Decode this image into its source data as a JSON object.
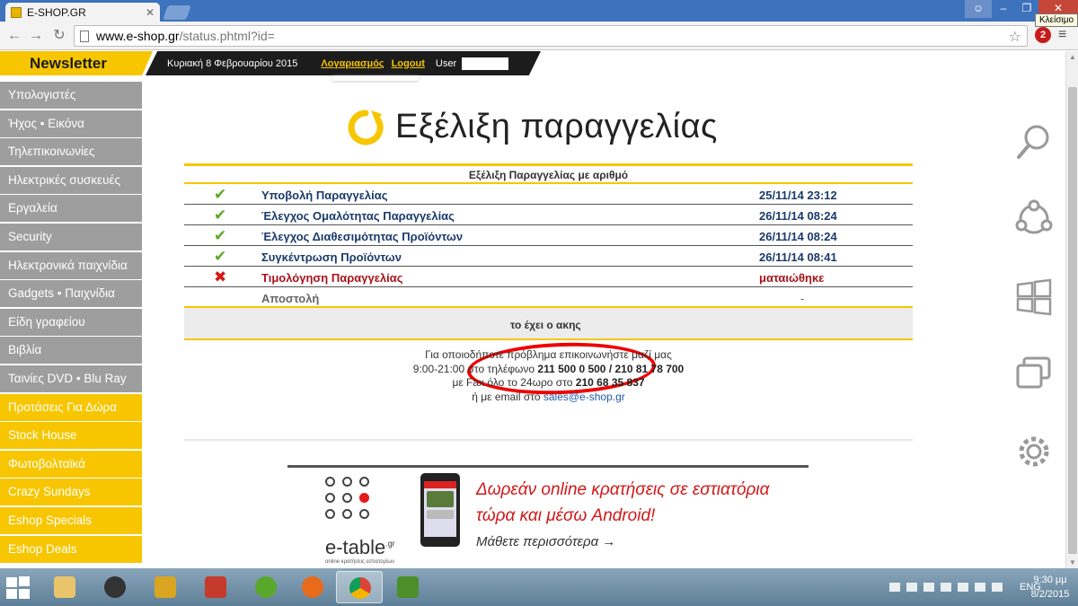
{
  "browser": {
    "tab_title": "E-SHOP.GR",
    "tab_close": "✕",
    "url_domain": "www.e-shop.gr",
    "url_path": "/status.phtml?id=",
    "tooltip": "Κλείσιμο",
    "ext_badge": "2"
  },
  "header": {
    "newsletter": "Newsletter",
    "date": "Κυριακή 8 Φεβρουαρίου 2015",
    "account_link": "Λογαριασμός",
    "logout_link": "Logout",
    "user_label": "User"
  },
  "sidebar": {
    "items": [
      {
        "label": "Υπολογιστές",
        "style": "gray"
      },
      {
        "label": "Ήχος • Εικόνα",
        "style": "gray"
      },
      {
        "label": "Τηλεπικοινωνίες",
        "style": "gray"
      },
      {
        "label": "Ηλεκτρικές συσκευές",
        "style": "gray"
      },
      {
        "label": "Εργαλεία",
        "style": "gray"
      },
      {
        "label": "Security",
        "style": "gray"
      },
      {
        "label": "Ηλεκτρονικά παιχνίδια",
        "style": "gray"
      },
      {
        "label": "Gadgets • Παιχνίδια",
        "style": "gray"
      },
      {
        "label": "Είδη γραφείου",
        "style": "gray"
      },
      {
        "label": "Βιβλία",
        "style": "gray"
      },
      {
        "label": "Ταινίες DVD • Blu Ray",
        "style": "gray"
      },
      {
        "label": "Προτάσεις Για Δώρα",
        "style": "yellow"
      },
      {
        "label": "Stock House",
        "style": "yellow"
      },
      {
        "label": "Φωτοβολταϊκά",
        "style": "yellow"
      },
      {
        "label": "Crazy Sundays",
        "style": "yellow"
      },
      {
        "label": "Eshop Specials",
        "style": "yellow"
      },
      {
        "label": "Eshop Deals",
        "style": "yellow"
      }
    ]
  },
  "main": {
    "title": "Εξέλιξη παραγγελίας",
    "panel_heading": "Εξέλιξη Παραγγελίας με αριθμό",
    "steps": [
      {
        "label": "Υποβολή Παραγγελίας",
        "time": "25/11/14 23:12",
        "status": "ok",
        "mark": "✔"
      },
      {
        "label": "Έλεγχος Ομαλότητας Παραγγελίας",
        "time": "26/11/14 08:24",
        "status": "ok",
        "mark": "✔"
      },
      {
        "label": "Έλεγχος Διαθεσιμότητας Προϊόντων",
        "time": "26/11/14 08:24",
        "status": "ok",
        "mark": "✔"
      },
      {
        "label": "Συγκέντρωση Προϊόντων",
        "time": "26/11/14 08:41",
        "status": "ok",
        "mark": "✔"
      },
      {
        "label": "Τιμολόγηση Παραγγελίας",
        "time": "ματαιώθηκε",
        "status": "error",
        "mark": "✖"
      },
      {
        "label": "Αποστολή",
        "time": "-",
        "status": "pending",
        "mark": ""
      }
    ],
    "note": "το έχει ο ακης"
  },
  "contact": {
    "line1": "Για οποιοδήποτε πρόβλημα επικοινωνήστε μαζί μας",
    "line2_prefix": "9:00-21:00 στο τηλέφωνο",
    "phones": "211 500 0 500 / 210 81 78 700",
    "line3_prefix": "με Fax όλο το 24ωρο στο",
    "fax": "210 68 35 837",
    "line4_prefix": "ή με email στο",
    "email": "sales@e-shop.gr"
  },
  "banner": {
    "logo_text": "e-table",
    "logo_suffix": ".gr",
    "logo_sub": "online κρατήσεις εστιατορίων",
    "line1": "Δωρεάν online κρατήσεις σε εστιατόρια",
    "line2": "τώρα και μέσω Android!",
    "link": "Μάθετε περισσότερα →"
  },
  "right_icons": [
    "search-icon",
    "network-icon",
    "windows-icon",
    "devices-icon",
    "settings-icon"
  ],
  "taskbar": {
    "lang": "ENG",
    "time": "9:30 μμ",
    "date": "8/2/2015"
  },
  "colors": {
    "brand_yellow": "#f7c600",
    "sidebar_gray": "#9e9e9e",
    "ok_green": "#5fa823",
    "error_red": "#a8141c",
    "annotation_red": "#e00000"
  }
}
